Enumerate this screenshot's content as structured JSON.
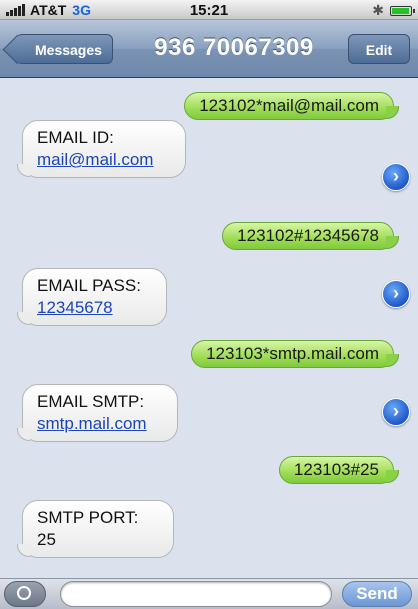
{
  "status": {
    "carrier": "AT&T",
    "network": "3G",
    "time": "15:21"
  },
  "nav": {
    "back_label": "Messages",
    "title": "936 70067309",
    "edit_label": "Edit"
  },
  "messages": [
    {
      "type": "sent",
      "text": "123102*mail@mail.com"
    },
    {
      "type": "received",
      "label": "EMAIL ID:",
      "value": "mail@mail.com"
    },
    {
      "type": "sent",
      "text": "123102#12345678"
    },
    {
      "type": "received",
      "label": "EMAIL PASS:",
      "value": "12345678"
    },
    {
      "type": "sent",
      "text": "123103*smtp.mail.com"
    },
    {
      "type": "received",
      "label": "EMAIL SMTP:",
      "value": "smtp.mail.com"
    },
    {
      "type": "sent",
      "text": "123103#25"
    },
    {
      "type": "received",
      "label": "SMTP PORT:",
      "value": "25"
    }
  ],
  "compose": {
    "placeholder": "",
    "send_label": "Send"
  },
  "colors": {
    "sent_bubble": "#9fdc56",
    "nav_bar": "#7b93b4",
    "background": "#dbe2ed",
    "detail_arrow": "#1e58c8"
  }
}
